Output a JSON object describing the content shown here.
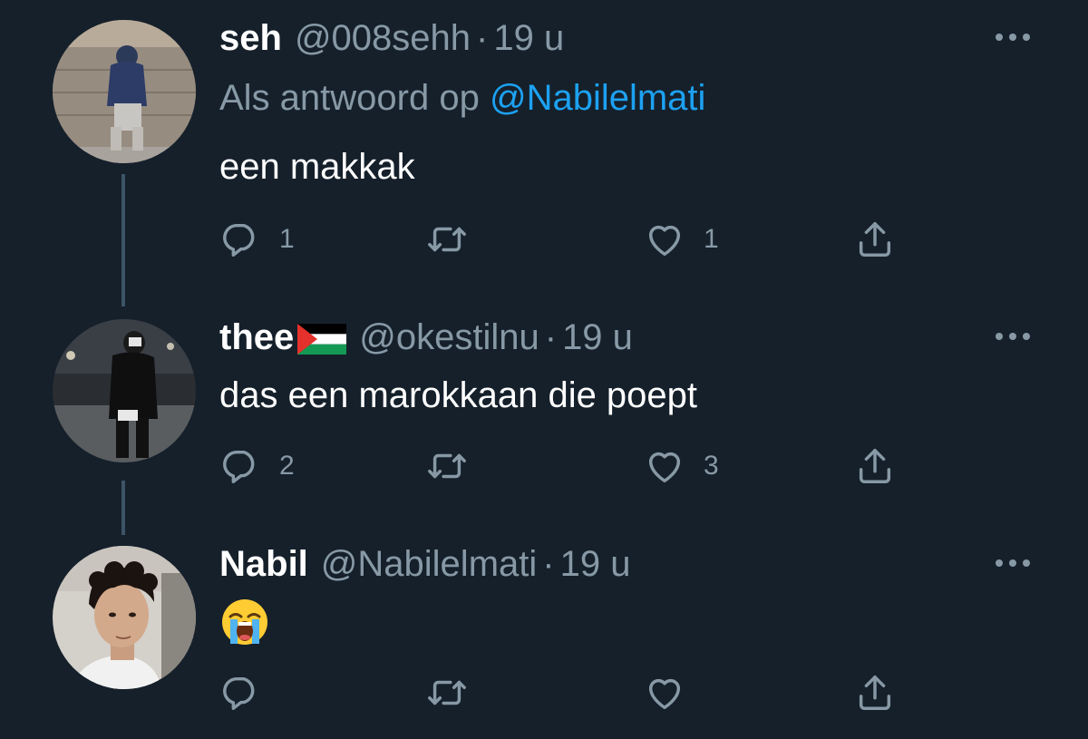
{
  "colors": {
    "background": "#15202b",
    "secondary_text": "#8899a6",
    "link": "#1da1f2",
    "thread_line": "#3d5466"
  },
  "tweets": [
    {
      "name": "seh",
      "handle": "@008sehh",
      "dot": "·",
      "time": "19 u",
      "reply_prefix": "Als antwoord op",
      "reply_to": "@Nabilelmati",
      "text": "een makkak",
      "replies": "1",
      "retweets": "",
      "likes": "1",
      "icons": [
        "reply-icon",
        "retweet-icon",
        "like-icon",
        "share-icon",
        "more-icon"
      ]
    },
    {
      "name": "thee",
      "name_flag": "palestine-flag",
      "handle": "@okestilnu",
      "dot": "·",
      "time": "19 u",
      "text": "das een marokkaan die poept",
      "replies": "2",
      "retweets": "",
      "likes": "3",
      "icons": [
        "reply-icon",
        "retweet-icon",
        "like-icon",
        "share-icon",
        "more-icon"
      ]
    },
    {
      "name": "Nabil",
      "handle": "@Nabilelmati",
      "dot": "·",
      "time": "19 u",
      "text_emoji": "loudly-crying-face-emoji",
      "replies": "",
      "retweets": "",
      "likes": "",
      "icons": [
        "reply-icon",
        "retweet-icon",
        "like-icon",
        "share-icon",
        "more-icon"
      ]
    }
  ]
}
